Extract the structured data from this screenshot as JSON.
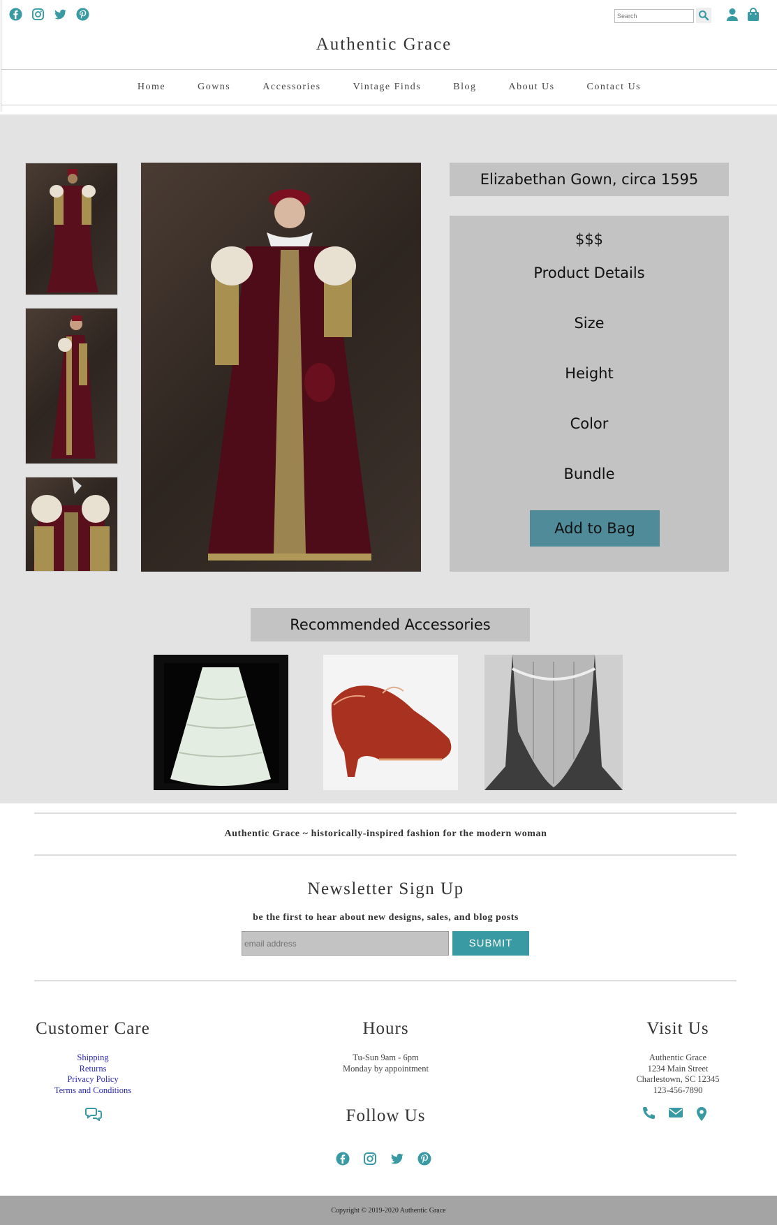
{
  "header": {
    "social": [
      "facebook-icon",
      "instagram-icon",
      "twitter-icon",
      "pinterest-icon"
    ],
    "search_placeholder": "Search",
    "site_title": "Authentic Grace"
  },
  "nav": {
    "items": [
      "Home",
      "Gowns",
      "Accessories",
      "Vintage Finds",
      "Blog",
      "About Us",
      "Contact Us"
    ]
  },
  "product": {
    "title": "Elizabethan Gown, circa 1595",
    "price": "$$$",
    "details_label": "Product Details",
    "options": [
      "Size",
      "Height",
      "Color",
      "Bundle"
    ],
    "add_button": "Add to Bag"
  },
  "recommended": {
    "title": "Recommended Accessories"
  },
  "footer": {
    "tagline": "Authentic Grace ~ historically-inspired fashion for the modern woman",
    "newsletter_title": "Newsletter Sign Up",
    "newsletter_sub": "be the first to hear about new designs, sales, and blog posts",
    "email_placeholder": "email address",
    "submit_label": "SUBMIT",
    "customer_care": {
      "title": "Customer Care",
      "links": [
        "Shipping",
        "Returns",
        "Privacy Policy",
        "Terms and Conditions"
      ]
    },
    "hours": {
      "title": "Hours",
      "lines": [
        "Tu-Sun 9am - 6pm",
        "Monday by appointment"
      ]
    },
    "follow_title": "Follow Us",
    "visit": {
      "title": "Visit Us",
      "lines": [
        "Authentic Grace",
        "1234 Main Street",
        "Charlestown, SC 12345",
        "123-456-7890"
      ]
    },
    "copyright": "Copyright © 2019-2020 Authentic Grace"
  },
  "colors": {
    "accent": "#3a9aa3",
    "button": "#4f8b99",
    "panel": "#c3c3c3",
    "background": "#e3e3e3"
  }
}
